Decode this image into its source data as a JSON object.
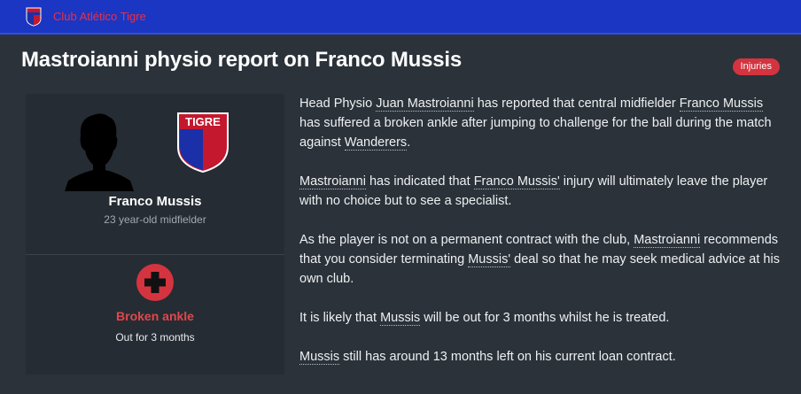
{
  "header": {
    "club_name": "Club Atlético Tigre",
    "badge_text": "TIGRE"
  },
  "page": {
    "title": "Mastroianni physio report on Franco Mussis",
    "tag": "Injuries"
  },
  "player_card": {
    "name": "Franco Mussis",
    "description": "23 year-old midfielder"
  },
  "injury_card": {
    "icon": "medical-cross-icon",
    "name": "Broken ankle",
    "duration": "Out for 3 months"
  },
  "report": {
    "p1": {
      "t1": "Head Physio ",
      "l1": "Juan Mastroianni",
      "t2": " has reported that central midfielder ",
      "l2": "Franco Mussis",
      "t3": " has suffered a broken ankle after jumping to challenge for the ball during the match against ",
      "l3": "Wanderers",
      "t4": "."
    },
    "p2": {
      "l1": "Mastroianni",
      "t1": " has indicated that ",
      "l2": "Franco Mussis'",
      "t2": " injury will ultimately leave the player with no choice but to see a specialist."
    },
    "p3": {
      "t1": "As the player is not on a permanent contract with the club, ",
      "l1": "Mastroianni",
      "t2": " recommends that you consider terminating ",
      "l2": "Mussis'",
      "t3": " deal so that he may seek medical advice at his own club."
    },
    "p4": {
      "t1": "It is likely that ",
      "l1": "Mussis",
      "t2": " will be out for 3 months whilst he is treated."
    },
    "p5": {
      "l1": "Mussis",
      "t1": " still has around 13 months left on his current loan contract."
    }
  },
  "colors": {
    "header_bg": "#1b36c3",
    "club_text": "#e6314a",
    "page_bg": "#2b323a",
    "panel_bg": "#252c33",
    "accent_red": "#d4343f"
  }
}
